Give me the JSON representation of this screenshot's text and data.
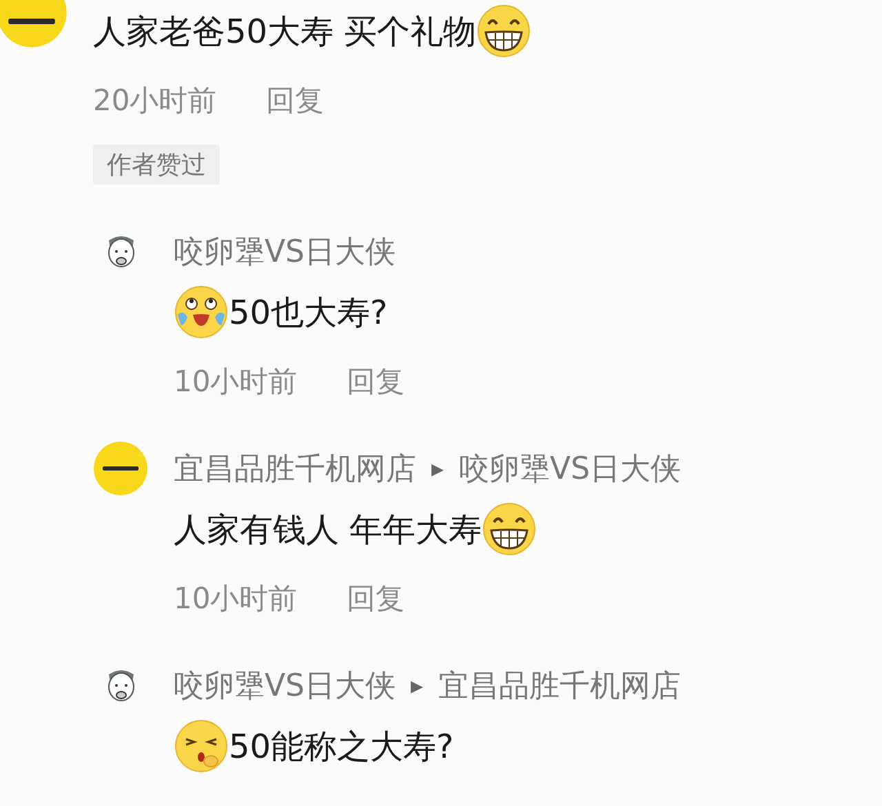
{
  "comment": {
    "avatar": {
      "kind": "logo"
    },
    "content": [
      {
        "kind": "text",
        "text": "人家老爸50大寿 买个礼物"
      },
      {
        "kind": "grin"
      }
    ],
    "time": "20小时前",
    "reply_button": "回复",
    "badge": "作者赞过"
  },
  "replies": [
    {
      "avatar": {
        "kind": "figure"
      },
      "author": "咬卵犟VS日大侠",
      "content": [
        {
          "kind": "tears"
        },
        {
          "kind": "text",
          "text": "50也大寿?"
        }
      ],
      "time": "10小时前",
      "reply_button": "回复"
    },
    {
      "avatar": {
        "kind": "logo"
      },
      "author": "宜昌品胜千机网店",
      "arrow": "▸",
      "reply_to": "咬卵犟VS日大侠",
      "content": [
        {
          "kind": "text",
          "text": "人家有钱人 年年大寿"
        },
        {
          "kind": "grin"
        }
      ],
      "time": "10小时前",
      "reply_button": "回复"
    },
    {
      "avatar": {
        "kind": "figure"
      },
      "author": "咬卵犟VS日大侠",
      "arrow": "▸",
      "reply_to": "宜昌品胜千机网店",
      "content": [
        {
          "kind": "wince"
        },
        {
          "kind": "text",
          "text": "50能称之大寿?"
        }
      ]
    }
  ]
}
